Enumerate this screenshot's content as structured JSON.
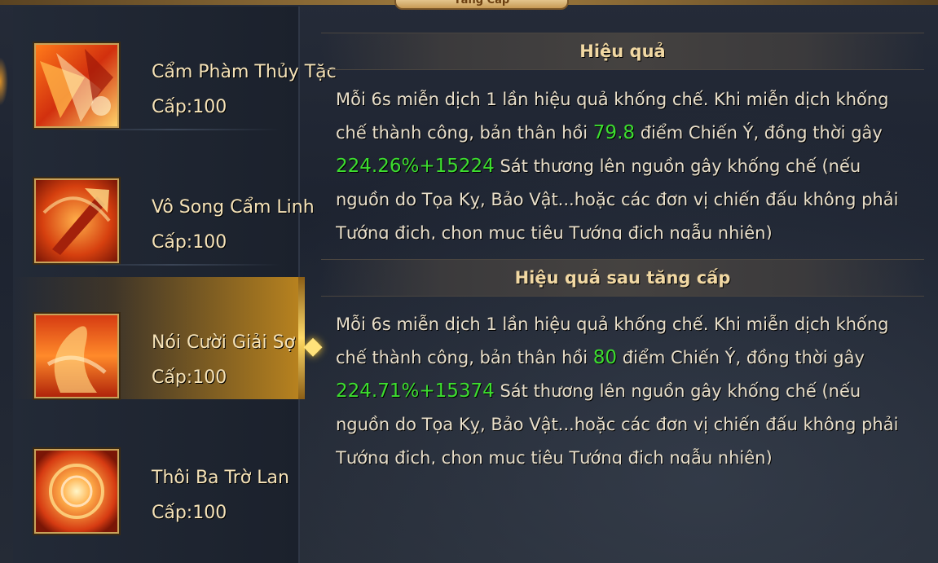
{
  "panel": {
    "title": "Tăng Cấp"
  },
  "skills": [
    {
      "name": "Cẩm Phàm Thủy Tặc",
      "level": "Cấp:100",
      "icon": "flame-claw-icon",
      "selected": false
    },
    {
      "name": "Vô Song Cẩm Linh",
      "level": "Cấp:100",
      "icon": "flame-blade-icon",
      "selected": false
    },
    {
      "name": "Nói Cười Giải Sợ",
      "level": "Cấp:100",
      "icon": "flame-swirl-icon",
      "selected": true
    },
    {
      "name": "Thôi Ba Trờ Lan",
      "level": "Cấp:100",
      "icon": "fire-vortex-icon",
      "selected": false
    }
  ],
  "current_effect": {
    "title": "Hiệu quả",
    "text_1": "Mỗi 6s miễn dịch 1 lần hiệu quả khống chế. Khi miễn dịch khống chế thành công, bản thân hồi ",
    "value_1": "79.8",
    "text_2": " điểm Chiến Ý, đồng thời gây ",
    "value_2": "224.26%+15224",
    "text_3": " Sát thương lên nguồn gây khống chế (nếu nguồn do Tọa Kỵ, Bảo Vật...hoặc các đơn vị chiến đấu không phải Tướng địch, chọn mục tiêu Tướng địch ngẫu nhiên)"
  },
  "upgraded_effect": {
    "title": "Hiệu quả sau tăng cấp",
    "text_1": "Mỗi 6s miễn dịch 1 lần hiệu quả khống chế. Khi miễn dịch khống chế thành công, bản thân hồi ",
    "value_1": "80",
    "text_2": " điểm Chiến Ý, đồng thời gây ",
    "value_2": "224.71%+15374",
    "text_3": " Sát thương lên nguồn gây khống chế (nếu nguồn do Tọa Kỵ, Bảo Vật...hoặc các đơn vị chiến đấu không phải Tướng địch, chọn mục tiêu Tướng địch ngẫu nhiên)"
  },
  "colors": {
    "highlight": "#3dde2f",
    "title_gold": "#f1d8a3",
    "selected_gold": "#b7821f"
  }
}
